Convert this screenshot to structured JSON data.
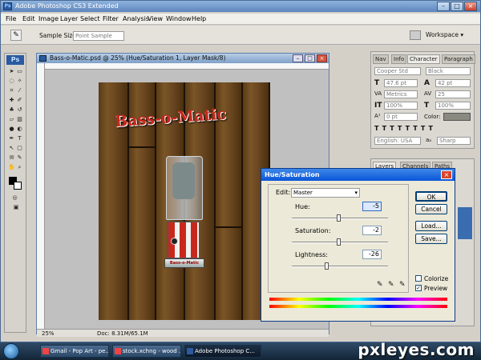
{
  "app": {
    "window_title": "Adobe Photoshop CS3 Extended",
    "menu": [
      "File",
      "Edit",
      "Image",
      "Layer",
      "Select",
      "Filter",
      "Analysis",
      "View",
      "Window",
      "Help"
    ],
    "options_bar": {
      "sample_size_label": "Sample Size:",
      "sample_size_value": "Point Sample",
      "workspace_label": "Workspace ▾"
    }
  },
  "document": {
    "title": "Bass-o-Matic.psd @ 25% (Hue/Saturation 1, Layer Mask/8)",
    "zoom": "25%",
    "doc_info": "Doc: 8.31M/65.1M",
    "canvas_logo_text": "Bass-o-Matic",
    "blender_label": "Bass-o-Matic"
  },
  "character_panel": {
    "tabs": [
      "Nav",
      "Info",
      "Character",
      "Paragraph"
    ],
    "font_family": "Cooper Std",
    "font_style": "Black",
    "font_size": "47.6 pt",
    "leading": "42 pt",
    "kerning": "Metrics",
    "tracking": "25",
    "vertical_scale": "100%",
    "horizontal_scale": "100%",
    "baseline_shift": "0 pt",
    "color_label": "Color:",
    "language": "English: USA",
    "antialias": "Sharp",
    "antialias_label": "aₐ"
  },
  "layers_panel": {
    "tabs": [
      "Layers",
      "Channels",
      "Paths"
    ]
  },
  "dialog": {
    "title": "Hue/Saturation",
    "edit_label": "Edit:",
    "edit_value": "Master",
    "hue_label": "Hue:",
    "hue_value": "-5",
    "saturation_label": "Saturation:",
    "saturation_value": "-2",
    "lightness_label": "Lightness:",
    "lightness_value": "-26",
    "ok_label": "OK",
    "cancel_label": "Cancel",
    "load_label": "Load...",
    "save_label": "Save...",
    "colorize_label": "Colorize",
    "preview_label": "Preview",
    "colorize_checked": false,
    "preview_checked": true,
    "hue_slider": 0.49,
    "saturation_slider": 0.49,
    "lightness_slider": 0.37
  },
  "taskbar": {
    "items": [
      {
        "label": "Gmail - Pop Art - pe...",
        "active": false
      },
      {
        "label": "stock.xchng - wood ...",
        "active": false
      },
      {
        "label": "Adobe Photoshop C...",
        "active": true
      }
    ]
  },
  "watermark": "pxleyes.com",
  "colors": {
    "title_blue": "#0a55d8",
    "wood": "#6b4a1f",
    "logo_red": "#c8281c"
  }
}
